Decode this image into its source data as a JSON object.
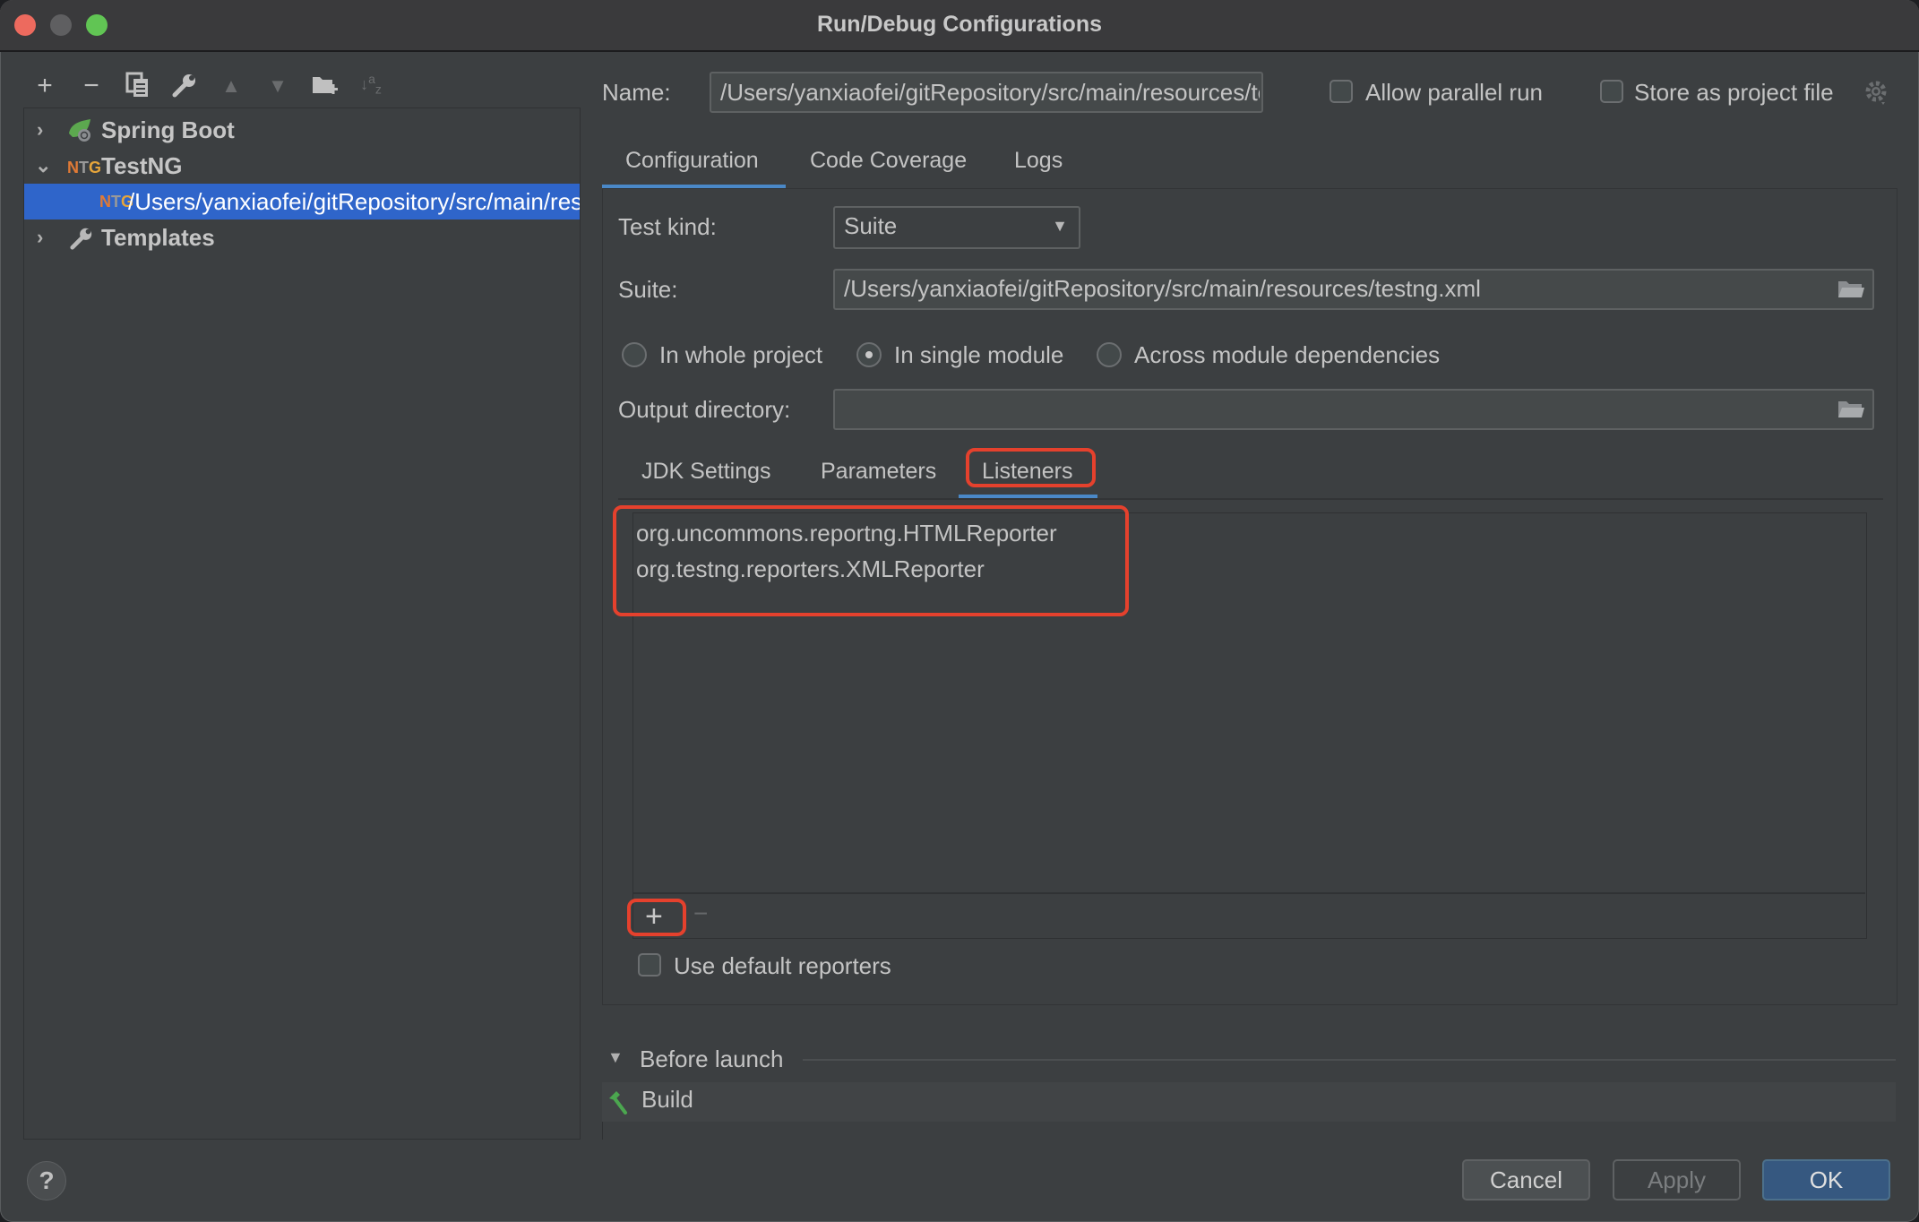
{
  "window": {
    "title": "Run/Debug Configurations",
    "traffic_lights": {
      "close": "#ed6a5e",
      "minimize": "#5f5f61",
      "maximize": "#61c554"
    }
  },
  "left_toolbar": {
    "icons": [
      "add-icon",
      "remove-icon",
      "copy-icon",
      "wrench-icon",
      "move-up-icon",
      "move-down-icon",
      "new-folder-icon",
      "sort-alpha-icon"
    ]
  },
  "tree": {
    "items": [
      {
        "label": "Spring Boot",
        "icon": "spring-boot-icon",
        "expanded": false
      },
      {
        "label": "TestNG",
        "icon": "testng-icon",
        "expanded": true
      },
      {
        "label": "/Users/yanxiaofei/gitRepository/src/main/resources/testng.xml",
        "icon": "testng-icon",
        "selected": true
      },
      {
        "label": "Templates",
        "icon": "wrench-icon",
        "expanded": false
      }
    ]
  },
  "header": {
    "name_label": "Name:",
    "name_value": "/Users/yanxiaofei/gitRepository/src/main/resources/testng.xml",
    "allow_parallel_label": "Allow parallel run",
    "allow_parallel_checked": false,
    "store_project_label": "Store as project file",
    "store_project_checked": false
  },
  "tabs": {
    "items": [
      "Configuration",
      "Code Coverage",
      "Logs"
    ],
    "active": "Configuration"
  },
  "config": {
    "test_kind_label": "Test kind:",
    "test_kind_value": "Suite",
    "suite_label": "Suite:",
    "suite_value": "/Users/yanxiaofei/gitRepository/src/main/resources/testng.xml",
    "scope_options": [
      "In whole project",
      "In single module",
      "Across module dependencies"
    ],
    "scope_selected": "In single module",
    "output_dir_label": "Output directory:",
    "output_dir_value": ""
  },
  "inner_tabs": {
    "items": [
      "JDK Settings",
      "Parameters",
      "Listeners"
    ],
    "active": "Listeners"
  },
  "listeners": {
    "items": [
      "org.uncommons.reportng.HTMLReporter",
      "org.testng.reporters.XMLReporter"
    ],
    "add_label": "+",
    "remove_label": "−",
    "use_default_label": "Use default reporters",
    "use_default_checked": false
  },
  "before_launch": {
    "label": "Before launch",
    "items": [
      "Build"
    ]
  },
  "footer": {
    "help_label": "?",
    "cancel_label": "Cancel",
    "apply_label": "Apply",
    "ok_label": "OK"
  },
  "colors": {
    "accent": "#4a88c7",
    "selection": "#2f65ca",
    "annotation_red": "#e5412d",
    "ok_button": "#365880"
  }
}
